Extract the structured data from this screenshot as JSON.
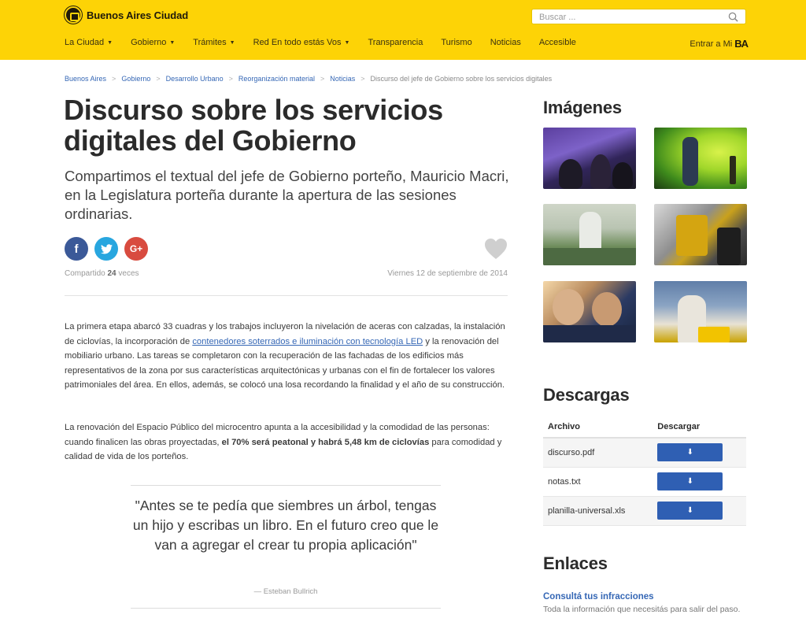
{
  "header": {
    "logo_text": "Buenos Aires Ciudad",
    "search_placeholder": "Buscar ...",
    "nav": [
      "La Ciudad",
      "Gobierno",
      "Trámites",
      "Red En todo estás Vos",
      "Transparencia",
      "Turismo",
      "Noticias",
      "Accesible"
    ],
    "nav_dropdown": [
      true,
      true,
      true,
      true,
      false,
      false,
      false,
      false
    ],
    "enter_label": "Entrar a Mi",
    "enter_brand": "BA",
    "background_color": "#fdd306"
  },
  "breadcrumb": {
    "items": [
      "Buenos Aires",
      "Gobierno",
      "Desarrollo Urbano",
      "Reorganización material",
      "Noticias"
    ],
    "current": "Discurso del jefe de Gobierno sobre los servicios digitales"
  },
  "article": {
    "title": "Discurso sobre los servicios digitales del Gobierno",
    "subtitle": "Compartimos el textual del jefe de Gobierno porteño, Mauricio Macri, en la Legislatura porteña durante la apertura de las sesiones ordinarias.",
    "social": [
      "f",
      "t",
      "G+"
    ],
    "shared_prefix": "Compartido",
    "shared_count": "24",
    "shared_suffix": "veces",
    "date": "Viernes 12 de septiembre de 2014",
    "p1_before": "La primera etapa abarcó 33 cuadras y los trabajos incluyeron la nivelación de aceras con calzadas, la instalación de ciclovías, la incorporación de ",
    "p1_link": "contenedores soterrados e iluminación con tecnología LED",
    "p1_after": " y la renovación del mobiliario urbano. Las tareas se completaron con la recuperación de las fachadas de los edificios más representativos de la zona por sus características arquitectónicas y urbanas con el fin de fortalecer los valores patrimoniales del área. En ellos, además, se colocó una losa recordando la finalidad y el año de su construcción.",
    "p2_before": "La renovación del Espacio Público del microcentro apunta a la accesibilidad y la comodidad de las personas: cuando finalicen las obras proyectadas, ",
    "p2_bold": "el 70% será peatonal y habrá 5,48 km de ciclovías",
    "p2_after": " para comodidad y calidad de vida de los porteños.",
    "quote": "\"Antes se te pedía que siembres un árbol, tengas un hijo y escribas un libro. En el futuro creo que le van a agregar el crear tu propia aplicación\"",
    "quote_author": "— Esteban Bullrich"
  },
  "sidebar": {
    "images_title": "Imágenes",
    "downloads_title": "Descargas",
    "downloads_columns": [
      "Archivo",
      "Descargar"
    ],
    "downloads": [
      {
        "file": "discurso.pdf",
        "button": "⬇"
      },
      {
        "file": "notas.txt",
        "button": "⬇"
      },
      {
        "file": "planilla-universal.xls",
        "button": "⬇"
      }
    ],
    "links_title": "Enlaces",
    "link_title": "Consultá tus infracciones",
    "link_desc": "Toda la información que necesitás para salir del paso."
  }
}
